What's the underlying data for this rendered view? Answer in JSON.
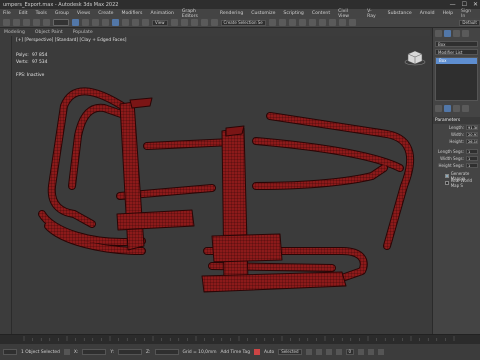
{
  "app": {
    "title": "umpers_Export.max - Autodesk 3ds Max 2022",
    "window_controls": [
      "—",
      "☐",
      "✕"
    ]
  },
  "menu": {
    "items": [
      "File",
      "Edit",
      "Tools",
      "Group",
      "Views",
      "Create",
      "Modifiers",
      "Animation",
      "Graph Editors",
      "Rendering",
      "Customize",
      "Scripting",
      "Content",
      "Civil View",
      "V-Ray",
      "Substance",
      "Arnold",
      "Help"
    ],
    "signin": "Sign In",
    "workspace": "Default"
  },
  "toolbar": {
    "view_dropdown": "View",
    "selection_set": "Create Selection Se"
  },
  "subtabs": [
    "Modeling",
    "Object Paint",
    "Populate"
  ],
  "viewport": {
    "label": "[+] [Perspective] [Standard] [Clay + Edged Faces]",
    "stats": {
      "polys_label": "Polys:",
      "polys_value": "97 854",
      "verts_label": "Verts:",
      "verts_value": "97 534"
    },
    "fps_label": "FPS:",
    "fps_value": "Inactive"
  },
  "command_panel": {
    "object_name": "Box",
    "modifier_list": "Modifier List",
    "stack_item": "Box",
    "rollout": "Parameters",
    "params": [
      {
        "label": "Length:",
        "value": "91.301"
      },
      {
        "label": "Width:",
        "value": "20.931"
      },
      {
        "label": "Height:",
        "value": "26.109"
      },
      {
        "label": "Length Segs:",
        "value": "1"
      },
      {
        "label": "Width Segs:",
        "value": "1"
      },
      {
        "label": "Height Segs:",
        "value": "1"
      }
    ],
    "checks": [
      {
        "label": "Generate Mappin",
        "checked": true
      },
      {
        "label": "Real-World Map S",
        "checked": false
      }
    ]
  },
  "timeline": {
    "ticks": [
      "0",
      "10",
      "20",
      "30",
      "40",
      "50",
      "60",
      "70",
      "80",
      "90",
      "100"
    ]
  },
  "status": {
    "selected": "1 Object Selected",
    "x": "X:",
    "y": "Y:",
    "z": "Z:",
    "grid": "Grid = 10,0mm",
    "add_tag": "Add Time Tag",
    "auto": "Auto",
    "key_mode": "Selected",
    "frame": "0"
  },
  "colors": {
    "model_red": "#8c1a1a",
    "model_wire": "#2a0505",
    "accent_blue": "#5e8ed0"
  }
}
